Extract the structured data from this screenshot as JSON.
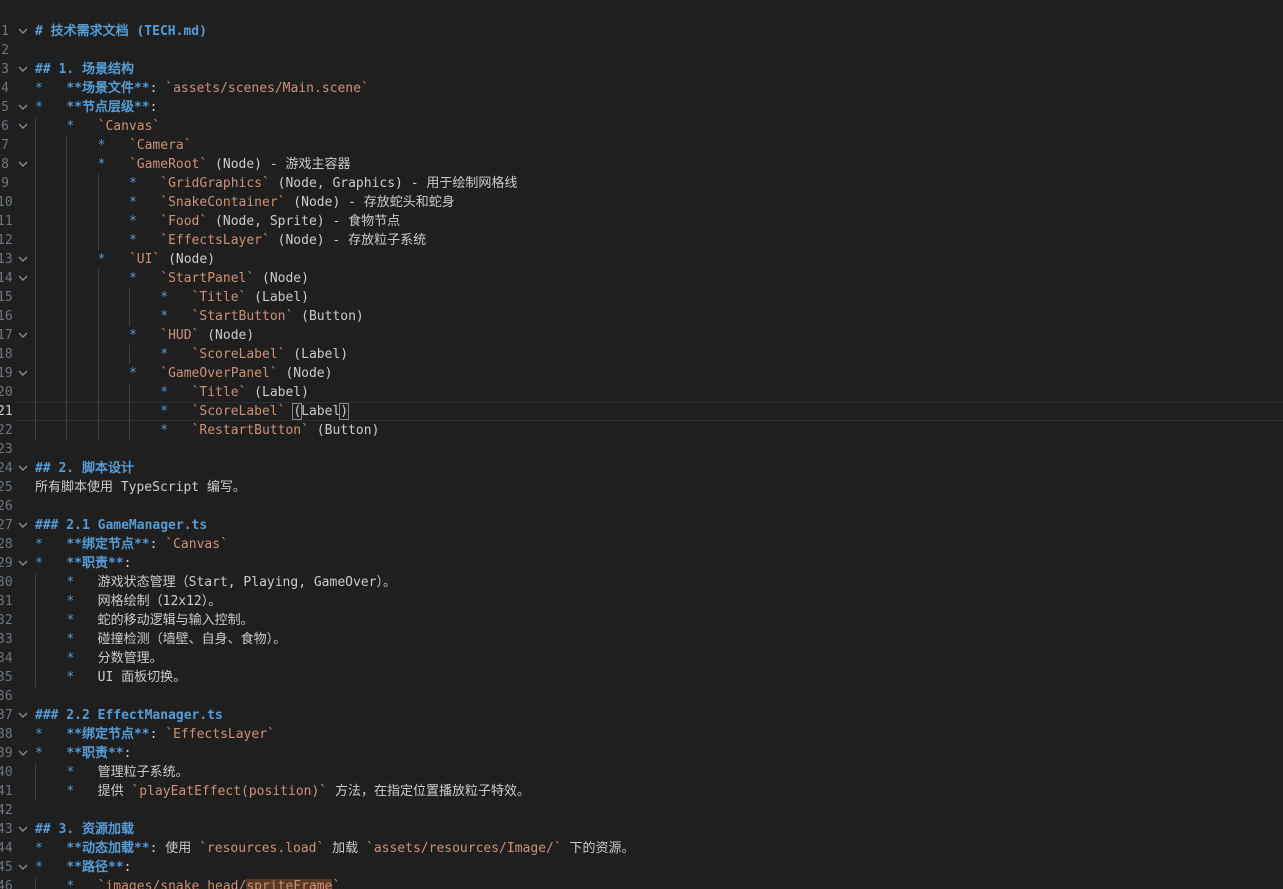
{
  "editor": {
    "lines": [
      {
        "n": "1",
        "current": false,
        "fold": true,
        "indent": 0,
        "tokens": [
          {
            "t": "h",
            "v": "# 技术需求文档 (TECH.md)"
          }
        ]
      },
      {
        "n": "2",
        "current": false,
        "fold": false,
        "indent": 0,
        "tokens": []
      },
      {
        "n": "3",
        "current": false,
        "fold": true,
        "indent": 0,
        "tokens": [
          {
            "t": "h",
            "v": "## 1. 场景结构"
          }
        ]
      },
      {
        "n": "4",
        "current": false,
        "fold": false,
        "indent": 0,
        "tokens": [
          {
            "t": "bullet",
            "v": "*   "
          },
          {
            "t": "b",
            "v": "**场景文件**"
          },
          {
            "t": "text",
            "v": ": "
          },
          {
            "t": "code",
            "v": "`assets/scenes/Main.scene`"
          }
        ]
      },
      {
        "n": "5",
        "current": false,
        "fold": true,
        "indent": 0,
        "tokens": [
          {
            "t": "bullet",
            "v": "*   "
          },
          {
            "t": "b",
            "v": "**节点层级**"
          },
          {
            "t": "text",
            "v": ":"
          }
        ]
      },
      {
        "n": "6",
        "current": false,
        "fold": true,
        "indent": 1,
        "tokens": [
          {
            "t": "bullet",
            "v": "*   "
          },
          {
            "t": "code",
            "v": "`Canvas`"
          }
        ]
      },
      {
        "n": "7",
        "current": false,
        "fold": false,
        "indent": 2,
        "tokens": [
          {
            "t": "bullet",
            "v": "*   "
          },
          {
            "t": "code",
            "v": "`Camera`"
          }
        ]
      },
      {
        "n": "8",
        "current": false,
        "fold": true,
        "indent": 2,
        "tokens": [
          {
            "t": "bullet",
            "v": "*   "
          },
          {
            "t": "code",
            "v": "`GameRoot`"
          },
          {
            "t": "text",
            "v": " (Node) - 游戏主容器"
          }
        ]
      },
      {
        "n": "9",
        "current": false,
        "fold": false,
        "indent": 3,
        "tokens": [
          {
            "t": "bullet",
            "v": "*   "
          },
          {
            "t": "code",
            "v": "`GridGraphics`"
          },
          {
            "t": "text",
            "v": " (Node, Graphics) - 用于绘制网格线"
          }
        ]
      },
      {
        "n": "10",
        "current": false,
        "fold": false,
        "indent": 3,
        "tokens": [
          {
            "t": "bullet",
            "v": "*   "
          },
          {
            "t": "code",
            "v": "`SnakeContainer`"
          },
          {
            "t": "text",
            "v": " (Node) - 存放蛇头和蛇身"
          }
        ]
      },
      {
        "n": "11",
        "current": false,
        "fold": false,
        "indent": 3,
        "tokens": [
          {
            "t": "bullet",
            "v": "*   "
          },
          {
            "t": "code",
            "v": "`Food`"
          },
          {
            "t": "text",
            "v": " (Node, Sprite) - 食物节点"
          }
        ]
      },
      {
        "n": "12",
        "current": false,
        "fold": false,
        "indent": 3,
        "tokens": [
          {
            "t": "bullet",
            "v": "*   "
          },
          {
            "t": "code",
            "v": "`EffectsLayer`"
          },
          {
            "t": "text",
            "v": " (Node) - 存放粒子系统"
          }
        ]
      },
      {
        "n": "13",
        "current": false,
        "fold": true,
        "indent": 2,
        "tokens": [
          {
            "t": "bullet",
            "v": "*   "
          },
          {
            "t": "code",
            "v": "`UI`"
          },
          {
            "t": "text",
            "v": " (Node)"
          }
        ]
      },
      {
        "n": "14",
        "current": false,
        "fold": true,
        "indent": 3,
        "tokens": [
          {
            "t": "bullet",
            "v": "*   "
          },
          {
            "t": "code",
            "v": "`StartPanel`"
          },
          {
            "t": "text",
            "v": " (Node)"
          }
        ]
      },
      {
        "n": "15",
        "current": false,
        "fold": false,
        "indent": 4,
        "tokens": [
          {
            "t": "bullet",
            "v": "*   "
          },
          {
            "t": "code",
            "v": "`Title`"
          },
          {
            "t": "text",
            "v": " (Label)"
          }
        ]
      },
      {
        "n": "16",
        "current": false,
        "fold": false,
        "indent": 4,
        "tokens": [
          {
            "t": "bullet",
            "v": "*   "
          },
          {
            "t": "code",
            "v": "`StartButton`"
          },
          {
            "t": "text",
            "v": " (Button)"
          }
        ]
      },
      {
        "n": "17",
        "current": false,
        "fold": true,
        "indent": 3,
        "tokens": [
          {
            "t": "bullet",
            "v": "*   "
          },
          {
            "t": "code",
            "v": "`HUD`"
          },
          {
            "t": "text",
            "v": " (Node)"
          }
        ]
      },
      {
        "n": "18",
        "current": false,
        "fold": false,
        "indent": 4,
        "tokens": [
          {
            "t": "bullet",
            "v": "*   "
          },
          {
            "t": "code",
            "v": "`ScoreLabel`"
          },
          {
            "t": "text",
            "v": " (Label)"
          }
        ]
      },
      {
        "n": "19",
        "current": false,
        "fold": true,
        "indent": 3,
        "tokens": [
          {
            "t": "bullet",
            "v": "*   "
          },
          {
            "t": "code",
            "v": "`GameOverPanel`"
          },
          {
            "t": "text",
            "v": " (Node)"
          }
        ]
      },
      {
        "n": "20",
        "current": false,
        "fold": false,
        "indent": 4,
        "tokens": [
          {
            "t": "bullet",
            "v": "*   "
          },
          {
            "t": "code",
            "v": "`Title`"
          },
          {
            "t": "text",
            "v": " (Label)"
          }
        ]
      },
      {
        "n": "21",
        "current": true,
        "fold": false,
        "indent": 4,
        "tokens": [
          {
            "t": "bullet",
            "v": "*   "
          },
          {
            "t": "code",
            "v": "`ScoreLabel`"
          },
          {
            "t": "text",
            "v": " "
          },
          {
            "t": "bracket",
            "v": "("
          },
          {
            "t": "text",
            "v": "Label"
          },
          {
            "t": "bracket",
            "v": ")"
          }
        ]
      },
      {
        "n": "22",
        "current": false,
        "fold": false,
        "indent": 4,
        "tokens": [
          {
            "t": "bullet",
            "v": "*   "
          },
          {
            "t": "code",
            "v": "`RestartButton`"
          },
          {
            "t": "text",
            "v": " (Button)"
          }
        ]
      },
      {
        "n": "23",
        "current": false,
        "fold": false,
        "indent": 0,
        "tokens": []
      },
      {
        "n": "24",
        "current": false,
        "fold": true,
        "indent": 0,
        "tokens": [
          {
            "t": "h",
            "v": "## 2. 脚本设计"
          }
        ]
      },
      {
        "n": "25",
        "current": false,
        "fold": false,
        "indent": 0,
        "tokens": [
          {
            "t": "text",
            "v": "所有脚本使用 TypeScript 编写。"
          }
        ]
      },
      {
        "n": "26",
        "current": false,
        "fold": false,
        "indent": 0,
        "tokens": []
      },
      {
        "n": "27",
        "current": false,
        "fold": true,
        "indent": 0,
        "tokens": [
          {
            "t": "h",
            "v": "### 2.1 GameManager.ts"
          }
        ]
      },
      {
        "n": "28",
        "current": false,
        "fold": false,
        "indent": 0,
        "tokens": [
          {
            "t": "bullet",
            "v": "*   "
          },
          {
            "t": "b",
            "v": "**绑定节点**"
          },
          {
            "t": "text",
            "v": ": "
          },
          {
            "t": "code",
            "v": "`Canvas`"
          }
        ]
      },
      {
        "n": "29",
        "current": false,
        "fold": true,
        "indent": 0,
        "tokens": [
          {
            "t": "bullet",
            "v": "*   "
          },
          {
            "t": "b",
            "v": "**职责**"
          },
          {
            "t": "text",
            "v": ":"
          }
        ]
      },
      {
        "n": "30",
        "current": false,
        "fold": false,
        "indent": 1,
        "tokens": [
          {
            "t": "bullet",
            "v": "*   "
          },
          {
            "t": "text",
            "v": "游戏状态管理（Start, Playing, GameOver）。"
          }
        ]
      },
      {
        "n": "31",
        "current": false,
        "fold": false,
        "indent": 1,
        "tokens": [
          {
            "t": "bullet",
            "v": "*   "
          },
          {
            "t": "text",
            "v": "网格绘制（12x12）。"
          }
        ]
      },
      {
        "n": "32",
        "current": false,
        "fold": false,
        "indent": 1,
        "tokens": [
          {
            "t": "bullet",
            "v": "*   "
          },
          {
            "t": "text",
            "v": "蛇的移动逻辑与输入控制。"
          }
        ]
      },
      {
        "n": "33",
        "current": false,
        "fold": false,
        "indent": 1,
        "tokens": [
          {
            "t": "bullet",
            "v": "*   "
          },
          {
            "t": "text",
            "v": "碰撞检测（墙壁、自身、食物）。"
          }
        ]
      },
      {
        "n": "34",
        "current": false,
        "fold": false,
        "indent": 1,
        "tokens": [
          {
            "t": "bullet",
            "v": "*   "
          },
          {
            "t": "text",
            "v": "分数管理。"
          }
        ]
      },
      {
        "n": "35",
        "current": false,
        "fold": false,
        "indent": 1,
        "tokens": [
          {
            "t": "bullet",
            "v": "*   "
          },
          {
            "t": "text",
            "v": "UI 面板切换。"
          }
        ]
      },
      {
        "n": "36",
        "current": false,
        "fold": false,
        "indent": 0,
        "tokens": []
      },
      {
        "n": "37",
        "current": false,
        "fold": true,
        "indent": 0,
        "tokens": [
          {
            "t": "h",
            "v": "### 2.2 EffectManager.ts"
          }
        ]
      },
      {
        "n": "38",
        "current": false,
        "fold": false,
        "indent": 0,
        "tokens": [
          {
            "t": "bullet",
            "v": "*   "
          },
          {
            "t": "b",
            "v": "**绑定节点**"
          },
          {
            "t": "text",
            "v": ": "
          },
          {
            "t": "code",
            "v": "`EffectsLayer`"
          }
        ]
      },
      {
        "n": "39",
        "current": false,
        "fold": true,
        "indent": 0,
        "tokens": [
          {
            "t": "bullet",
            "v": "*   "
          },
          {
            "t": "b",
            "v": "**职责**"
          },
          {
            "t": "text",
            "v": ":"
          }
        ]
      },
      {
        "n": "40",
        "current": false,
        "fold": false,
        "indent": 1,
        "tokens": [
          {
            "t": "bullet",
            "v": "*   "
          },
          {
            "t": "text",
            "v": "管理粒子系统。"
          }
        ]
      },
      {
        "n": "41",
        "current": false,
        "fold": false,
        "indent": 1,
        "tokens": [
          {
            "t": "bullet",
            "v": "*   "
          },
          {
            "t": "text",
            "v": "提供 "
          },
          {
            "t": "code",
            "v": "`playEatEffect(position)`"
          },
          {
            "t": "text",
            "v": " 方法，在指定位置播放粒子特效。"
          }
        ]
      },
      {
        "n": "42",
        "current": false,
        "fold": false,
        "indent": 0,
        "tokens": []
      },
      {
        "n": "43",
        "current": false,
        "fold": true,
        "indent": 0,
        "tokens": [
          {
            "t": "h",
            "v": "## 3. 资源加载"
          }
        ]
      },
      {
        "n": "44",
        "current": false,
        "fold": false,
        "indent": 0,
        "tokens": [
          {
            "t": "bullet",
            "v": "*   "
          },
          {
            "t": "b",
            "v": "**动态加载**"
          },
          {
            "t": "text",
            "v": ": 使用 "
          },
          {
            "t": "code",
            "v": "`resources.load`"
          },
          {
            "t": "text",
            "v": " 加载 "
          },
          {
            "t": "code",
            "v": "`assets/resources/Image/`"
          },
          {
            "t": "text",
            "v": " 下的资源。"
          }
        ]
      },
      {
        "n": "45",
        "current": false,
        "fold": true,
        "indent": 0,
        "tokens": [
          {
            "t": "bullet",
            "v": "*   "
          },
          {
            "t": "b",
            "v": "**路径**"
          },
          {
            "t": "text",
            "v": ":"
          }
        ]
      },
      {
        "n": "46",
        "current": false,
        "fold": false,
        "indent": 1,
        "tokens": [
          {
            "t": "bullet",
            "v": "*   "
          },
          {
            "t": "code",
            "v": "`images/snake_head/"
          },
          {
            "t": "hl",
            "v": "spriteFrame"
          },
          {
            "t": "code",
            "v": "`"
          }
        ]
      }
    ]
  }
}
